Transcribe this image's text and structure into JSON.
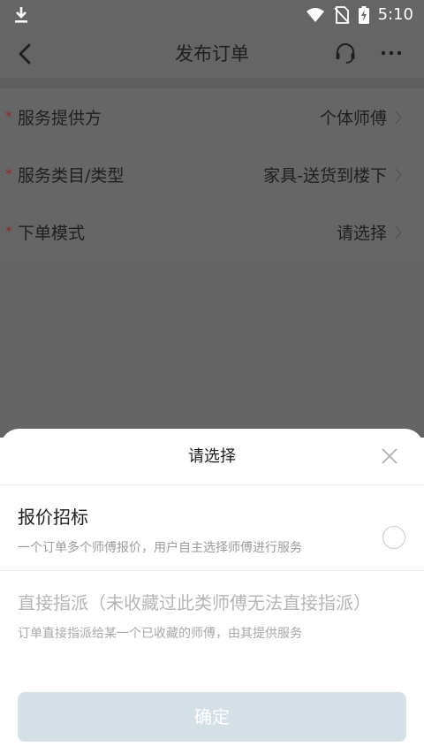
{
  "status_bar": {
    "time": "5:10",
    "icons": [
      "download-icon",
      "wifi-icon",
      "no-sim-icon",
      "battery-charging-icon"
    ]
  },
  "nav": {
    "title": "发布订单",
    "icons": [
      "back-icon",
      "headset-icon",
      "more-icon"
    ]
  },
  "form": {
    "rows": [
      {
        "required": "*",
        "label": "服务提供方",
        "value": "个体师傅"
      },
      {
        "required": "*",
        "label": "服务类目/类型",
        "value": "家具-送货到楼下"
      },
      {
        "required": "*",
        "label": "下单模式",
        "value": "请选择"
      }
    ]
  },
  "sheet": {
    "title": "请选择",
    "options": [
      {
        "title": "报价招标",
        "desc": "一个订单多个师傅报价，用户自主选择师傅进行服务",
        "enabled": true,
        "selected": false
      },
      {
        "title": "直接指派（未收藏过此类师傅无法直接指派）",
        "desc": "订单直接指派给某一个已收藏的师傅，由其提供服务",
        "enabled": false
      }
    ],
    "confirm_label": "确定"
  },
  "colors": {
    "dim_overlay": "#656565",
    "required_star": "#8a2e2e",
    "confirm_disabled": "#d4e0e6",
    "disabled_text": "#b5b5b5"
  }
}
